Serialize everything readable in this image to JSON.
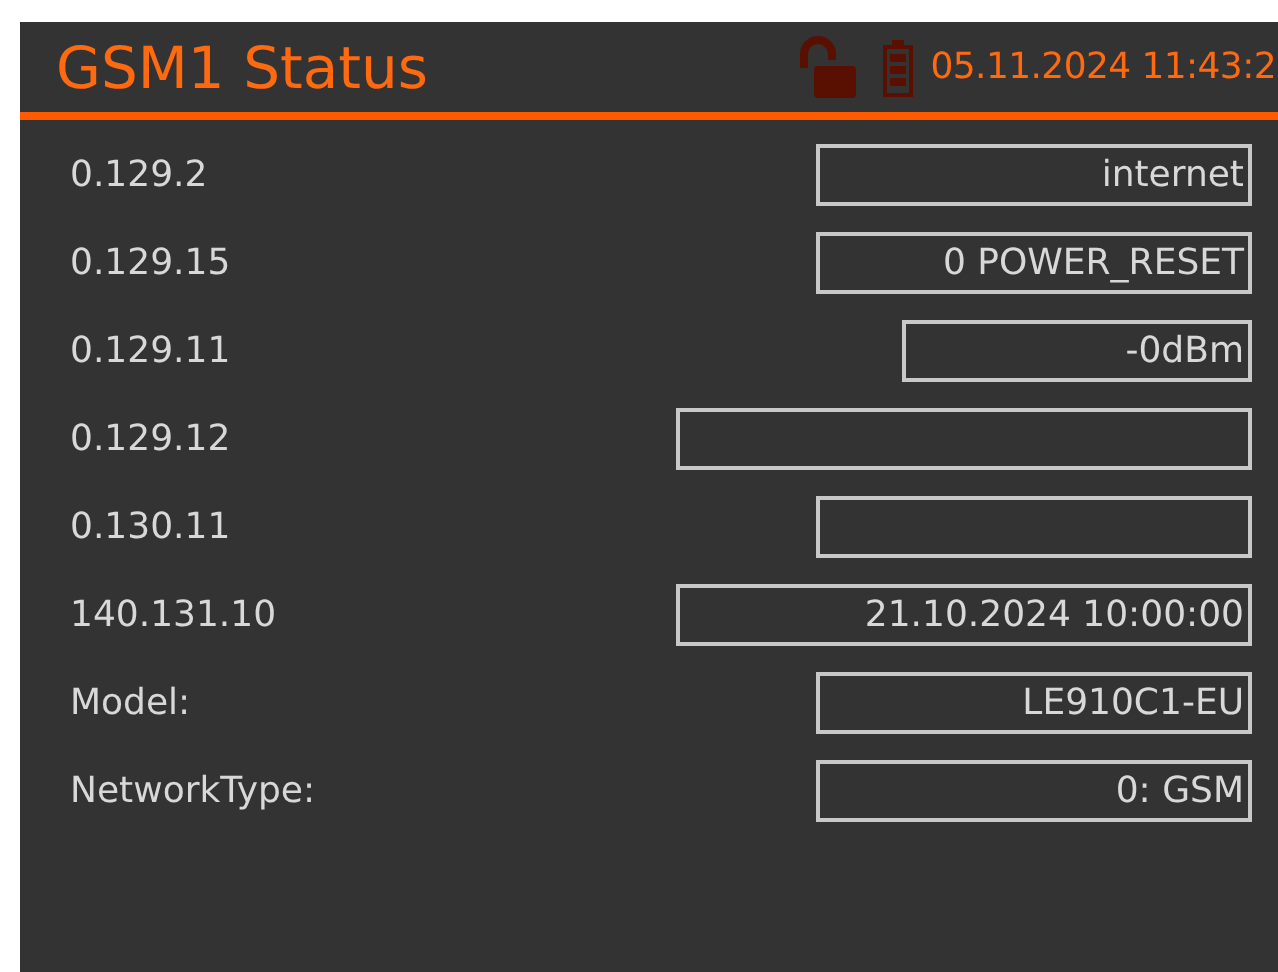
{
  "header": {
    "title": "GSM1 Status",
    "datetime": "05.11.2024 11:43:2",
    "locked": false
  },
  "rows": [
    {
      "label": "0.129.2",
      "value": "internet",
      "kind": "normal"
    },
    {
      "label": "0.129.15",
      "value": "0 POWER_RESET",
      "kind": "normal"
    },
    {
      "label": "0.129.11",
      "value": "-0dBm",
      "kind": "short"
    },
    {
      "label": "0.129.12",
      "kind": "wide"
    },
    {
      "label": "0.130.11",
      "kind": "normal"
    },
    {
      "label": "140.131.10",
      "value": "21.10.2024 10:00:00",
      "kind": "wide"
    },
    {
      "label": "Model:",
      "value": "LE910C1-EU",
      "kind": "normal"
    },
    {
      "label": "NetworkType:",
      "value": "0: GSM",
      "kind": "normal"
    }
  ]
}
